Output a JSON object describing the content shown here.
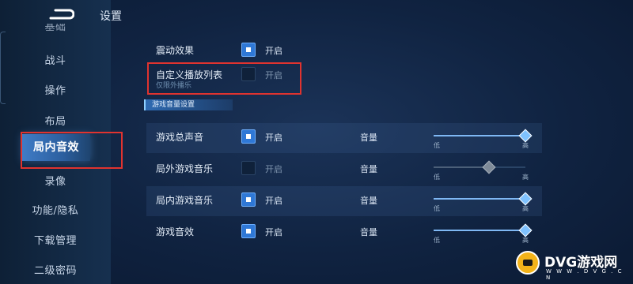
{
  "header": {
    "title": "设置"
  },
  "sidebar": {
    "items": [
      {
        "label": "基础"
      },
      {
        "label": "战斗"
      },
      {
        "label": "操作"
      },
      {
        "label": "布局"
      },
      {
        "label": "局内音效",
        "active": true
      },
      {
        "label": "录像"
      },
      {
        "label": "功能/隐私"
      },
      {
        "label": "下载管理"
      },
      {
        "label": "二级密码"
      }
    ]
  },
  "settings": {
    "vibration": {
      "label": "震动效果",
      "checked": true,
      "toggle_label": "开启"
    },
    "custom_playlist": {
      "label": "自定义播放列表",
      "sub": "仅限外播乐",
      "checked": false,
      "toggle_label": "开启"
    }
  },
  "section": {
    "title": "游戏音量设置"
  },
  "volume_rows": [
    {
      "label": "游戏总声音",
      "checked": true,
      "toggle_label": "开启",
      "volume_label": "音量",
      "low": "低",
      "high": "高",
      "level": 1.0
    },
    {
      "label": "局外游戏音乐",
      "checked": false,
      "toggle_label": "开启",
      "volume_label": "音量",
      "low": "低",
      "high": "高",
      "level": 0.6
    },
    {
      "label": "局内游戏音乐",
      "checked": true,
      "toggle_label": "开启",
      "volume_label": "音量",
      "low": "低",
      "high": "高",
      "level": 1.0
    },
    {
      "label": "游戏音效",
      "checked": true,
      "toggle_label": "开启",
      "volume_label": "音量",
      "low": "低",
      "high": "高",
      "level": 1.0
    }
  ],
  "watermark": {
    "brand": "DVG游戏网",
    "domain": "W W W . D V G . C N"
  },
  "colors": {
    "accent": "#2f78d6",
    "highlight": "#e0332f",
    "background": "#102341"
  }
}
